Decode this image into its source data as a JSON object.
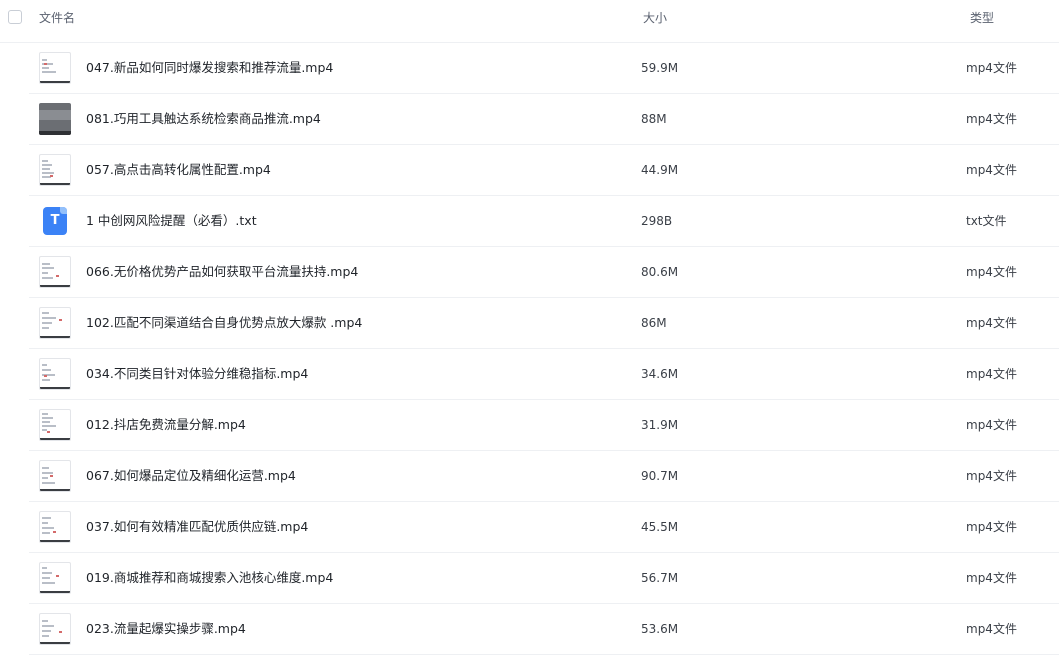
{
  "header": {
    "name_label": "文件名",
    "size_label": "大小",
    "type_label": "类型"
  },
  "files": [
    {
      "name": "047.新品如何同时爆发搜索和推荐流量.mp4",
      "size": "59.9M",
      "type": "mp4文件",
      "icon": "video-thumbnail"
    },
    {
      "name": "081.巧用工具触达系统检索商品推流.mp4",
      "size": "88M",
      "type": "mp4文件",
      "icon": "video-thumbnail"
    },
    {
      "name": "057.高点击高转化属性配置.mp4",
      "size": "44.9M",
      "type": "mp4文件",
      "icon": "video-thumbnail"
    },
    {
      "name": "1 中创网风险提醒（必看）.txt",
      "size": "298B",
      "type": "txt文件",
      "icon": "txt-file-icon"
    },
    {
      "name": "066.无价格优势产品如何获取平台流量扶持.mp4",
      "size": "80.6M",
      "type": "mp4文件",
      "icon": "video-thumbnail"
    },
    {
      "name": "102.匹配不同渠道结合自身优势点放大爆款 .mp4",
      "size": "86M",
      "type": "mp4文件",
      "icon": "video-thumbnail"
    },
    {
      "name": "034.不同类目针对体验分维稳指标.mp4",
      "size": "34.6M",
      "type": "mp4文件",
      "icon": "video-thumbnail"
    },
    {
      "name": "012.抖店免费流量分解.mp4",
      "size": "31.9M",
      "type": "mp4文件",
      "icon": "video-thumbnail"
    },
    {
      "name": "067.如何爆品定位及精细化运营.mp4",
      "size": "90.7M",
      "type": "mp4文件",
      "icon": "video-thumbnail"
    },
    {
      "name": "037.如何有效精准匹配优质供应链.mp4",
      "size": "45.5M",
      "type": "mp4文件",
      "icon": "video-thumbnail"
    },
    {
      "name": "019.商城推荐和商城搜索入池核心维度.mp4",
      "size": "56.7M",
      "type": "mp4文件",
      "icon": "video-thumbnail"
    },
    {
      "name": "023.流量起爆实操步骤.mp4",
      "size": "53.6M",
      "type": "mp4文件",
      "icon": "video-thumbnail"
    }
  ],
  "txt_icon_letter": "T",
  "colors": {
    "txt_icon": "#3b82f6",
    "divider": "#eef0f3"
  }
}
